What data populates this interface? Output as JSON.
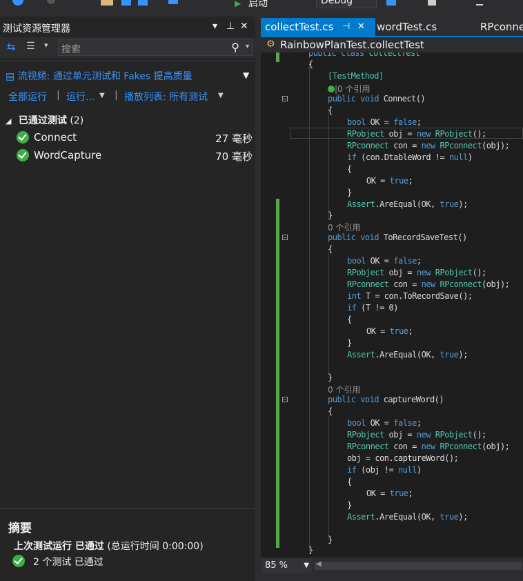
{
  "toolbar": {
    "start_label": "启动",
    "config_value": "Debug"
  },
  "test_explorer": {
    "title": "测试资源管理器",
    "search_placeholder": "搜索",
    "promo_text": "流视频: 通过单元测试和 Fakes 提高质量",
    "run_all": "全部运行",
    "run": "运行...",
    "playlist": "播放列表: 所有测试",
    "group_header": "已通过测试",
    "group_count": "(2)",
    "tests": [
      {
        "name": "Connect",
        "time": "27 毫秒"
      },
      {
        "name": "WordCapture",
        "time": "70 毫秒"
      }
    ],
    "summary": {
      "title": "摘要",
      "last_run_label": "上次测试运行 已通过",
      "last_run_detail": "(总运行时间 0:00:00)",
      "count_text": "2 个测试 已通过"
    }
  },
  "editor": {
    "tabs": [
      "collectTest.cs",
      "wordTest.cs",
      "RPconne"
    ],
    "nav_class": "RainbowPlanTest.collectTest",
    "zoom": "85 %",
    "codelens_1": "|0 个引用",
    "codelens_2": "0 个引用",
    "codelens_3": "0 个引用",
    "lines": {
      "l0": "    public class collectTest",
      "l1": "    {",
      "l2": "[TestMethod]",
      "l4a": "public void ",
      "l4b": "Connect()",
      "brace": "{",
      "brace_close": "}"
    }
  }
}
